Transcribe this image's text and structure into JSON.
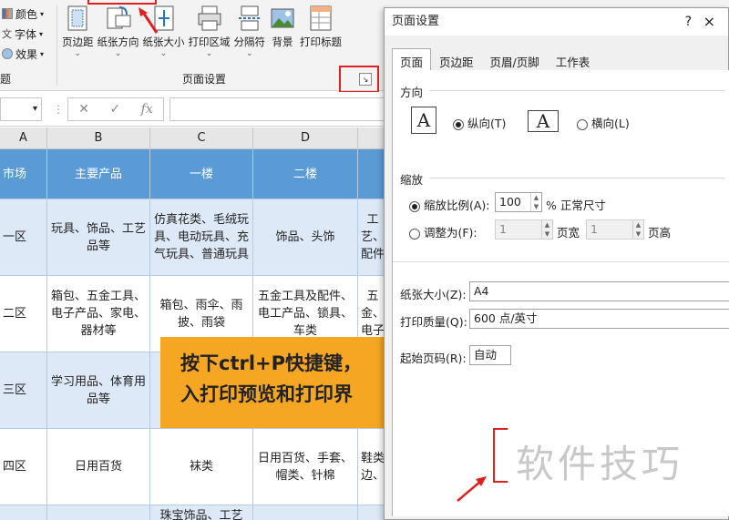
{
  "ribbon": {
    "themes": [
      {
        "label": "颜色",
        "icon": "theme-colors-icon"
      },
      {
        "label": "字体",
        "icon": "theme-fonts-icon"
      },
      {
        "label": "效果",
        "icon": "theme-effects-icon"
      }
    ],
    "themes_group_label": "题",
    "buttons": [
      {
        "label": "页边距",
        "icon": "margins-icon"
      },
      {
        "label": "纸张方向",
        "icon": "orientation-icon"
      },
      {
        "label": "纸张大小",
        "icon": "paper-size-icon"
      },
      {
        "label": "打印区域",
        "icon": "print-area-icon"
      },
      {
        "label": "分隔符",
        "icon": "breaks-icon"
      },
      {
        "label": "背景",
        "icon": "background-icon"
      },
      {
        "label": "打印标题",
        "icon": "print-titles-icon"
      }
    ],
    "group_label": "页面设置",
    "accent_red": "#e02020"
  },
  "formula_bar": {
    "fx_label": "fx",
    "value": ""
  },
  "columns": [
    "A",
    "B",
    "C",
    "D"
  ],
  "table": {
    "header": [
      "市场",
      "主要产品",
      "一楼",
      "二楼",
      ""
    ],
    "rows": [
      [
        "一区",
        "玩具、饰品、工艺品等",
        "仿真花类、毛绒玩具、电动玩具、充气玩具、普通玩具",
        "饰品、头饰",
        "工艺、配件"
      ],
      [
        "二区",
        "箱包、五金工具、电子产品、家电、器材等",
        "箱包、雨伞、雨披、雨袋",
        "五金工具及配件、电工产品、锁具、车类",
        "五金、电子"
      ],
      [
        "三区",
        "学习用品、体育用品等",
        "",
        "",
        ""
      ],
      [
        "四区",
        "日用百货",
        "袜类",
        "日用百货、手套、帽类、针棉",
        "鞋类边、"
      ],
      [
        "",
        "",
        "珠宝饰品、工艺",
        "",
        ""
      ]
    ],
    "colors": {
      "header": "#5b9bd5",
      "band": "#dde9f6"
    }
  },
  "callout": {
    "line1": "按下ctrl+P快捷键，",
    "line2": "入打印预览和打印界",
    "color": "#f5a623"
  },
  "dialog": {
    "title": "页面设置",
    "help": "?",
    "close": "×",
    "tabs": [
      "页面",
      "页边距",
      "页眉/页脚",
      "工作表"
    ],
    "orientation": {
      "label": "方向",
      "portrait": "纵向(T)",
      "landscape": "横向(L)",
      "selected": "portrait"
    },
    "scaling": {
      "label": "缩放",
      "adjust_label": "缩放比例(A):",
      "adjust_value": "100",
      "adjust_suffix": "% 正常尺寸",
      "fit_label": "调整为(F):",
      "fit_wide": "1",
      "fit_wide_suffix": "页宽",
      "fit_tall": "1",
      "fit_tall_suffix": "页高"
    },
    "paper_size_label": "纸张大小(Z):",
    "paper_size_value": "A4",
    "print_quality_label": "打印质量(Q):",
    "print_quality_value": "600 点/英寸",
    "first_page_label": "起始页码(R):",
    "first_page_value": "自动"
  },
  "watermark": "软件技巧"
}
